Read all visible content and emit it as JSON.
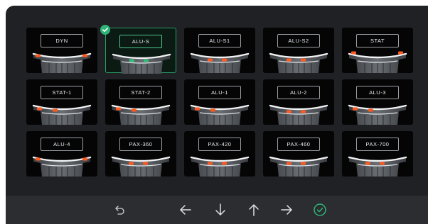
{
  "tiles": [
    {
      "label": "DYN",
      "markers": "weights-outer",
      "selected": false
    },
    {
      "label": "ALU-S",
      "markers": "weights-inner",
      "selected": true
    },
    {
      "label": "ALU-S1",
      "markers": "weights-inner",
      "selected": false
    },
    {
      "label": "ALU-S2",
      "markers": "weights-inner",
      "selected": false
    },
    {
      "label": "STAT",
      "markers": "weights-top",
      "selected": false
    },
    {
      "label": "STAT-1",
      "markers": "weights-left",
      "selected": false
    },
    {
      "label": "STAT-2",
      "markers": "weights-left",
      "selected": false
    },
    {
      "label": "ALU-1",
      "markers": "weights-left",
      "selected": false
    },
    {
      "label": "ALU-2",
      "markers": "weights-inner",
      "selected": false
    },
    {
      "label": "ALU-3",
      "markers": "weights-left",
      "selected": false
    },
    {
      "label": "ALU-4",
      "markers": "weights-outer",
      "selected": false
    },
    {
      "label": "PAX-360",
      "markers": "weights-inner",
      "selected": false
    },
    {
      "label": "PAX-420",
      "markers": "weights-inner",
      "selected": false
    },
    {
      "label": "PAX-460",
      "markers": "weights-inner",
      "selected": false
    },
    {
      "label": "PAX-700",
      "markers": "weights-inner",
      "selected": false
    }
  ],
  "colors": {
    "weight_default": "#ff5a1f",
    "weight_selected": "#35c07a",
    "accent": "#2fb477"
  },
  "navigation": [
    {
      "icon": "undo-icon",
      "name": "undo-button"
    },
    {
      "icon": "arrow-left-icon",
      "name": "left-button"
    },
    {
      "icon": "arrow-down-icon",
      "name": "down-button"
    },
    {
      "icon": "arrow-up-icon",
      "name": "up-button"
    },
    {
      "icon": "arrow-right-icon",
      "name": "right-button"
    },
    {
      "icon": "check-circle-icon",
      "name": "confirm-button"
    }
  ]
}
